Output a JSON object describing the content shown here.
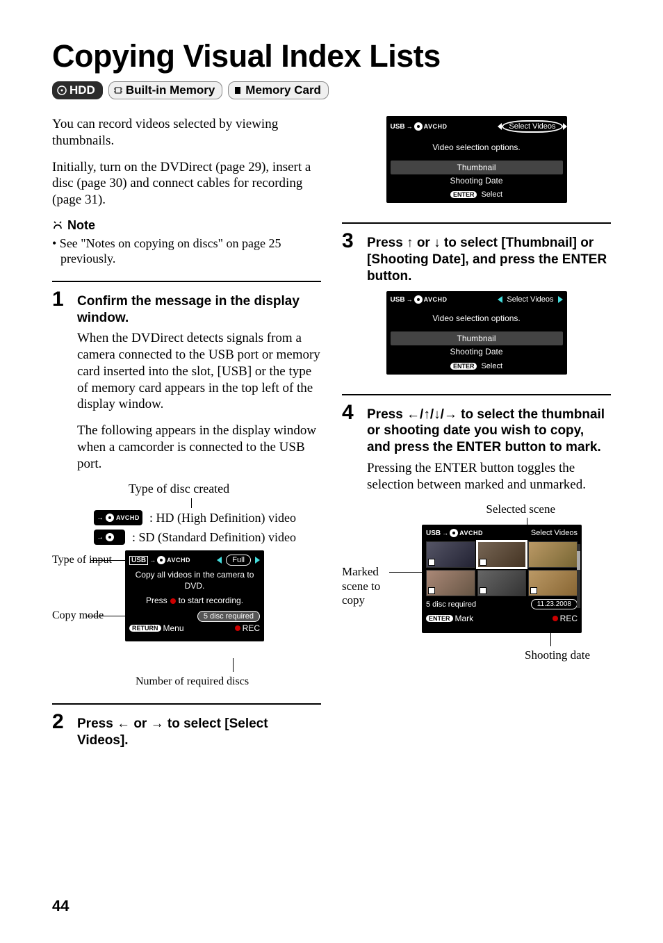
{
  "title": "Copying Visual Index Lists",
  "badges": {
    "hdd": "HDD",
    "builtin": "Built-in Memory",
    "card": "Memory Card"
  },
  "intro": {
    "p1": "You can record videos selected by viewing thumbnails.",
    "p2": "Initially, turn on the DVDirect (page 29), insert a disc (page 30) and connect cables for recording (page 31)."
  },
  "note": {
    "head": "Note",
    "body": "• See \"Notes on copying on discs\" on page 25 previously."
  },
  "step1": {
    "num": "1",
    "head": "Confirm the message in the display window.",
    "body1": "When the DVDirect detects signals from a camera connected to the USB port or memory card inserted into the slot, [USB] or the type of memory card appears in the top left of the display window.",
    "body2": "The following appears in the display window when a camcorder is connected to the USB port.",
    "caption_top": "Type of disc created",
    "legend_hd": ": HD (High Definition) video",
    "legend_sd": ": SD (Standard Definition) video",
    "label_input": "Type of input",
    "label_copy": "Copy mode",
    "caption_bottom": "Number of required discs"
  },
  "lcd1": {
    "usb": "USB",
    "avchd": "AVCHD",
    "full": "Full",
    "msg": "Copy all videos in the camera to DVD.",
    "press": "Press      to start recording.",
    "discs": "5 disc required",
    "return": "Menu",
    "return_btn": "RETURN",
    "rec": "REC"
  },
  "step2": {
    "num": "2",
    "head_prefix": "Press ",
    "head_mid": " or ",
    "head_suffix": " to select [Select Videos]."
  },
  "lcd2": {
    "usb": "USB",
    "avchd": "AVCHD",
    "sel": "Select Videos",
    "msg": "Video selection options.",
    "opt1": "Thumbnail",
    "opt2": "Shooting Date",
    "enter": "ENTER",
    "select": "Select"
  },
  "step3": {
    "num": "3",
    "head_prefix": "Press ",
    "head_mid": " or ",
    "head_mid2": " to select [Thumbnail] or [Shooting Date], and press the ENTER button."
  },
  "lcd3": {
    "usb": "USB",
    "avchd": "AVCHD",
    "sel": "Select Videos",
    "msg": "Video selection options.",
    "opt1": "Thumbnail",
    "opt2": "Shooting Date",
    "enter": "ENTER",
    "select": "Select"
  },
  "step4": {
    "num": "4",
    "head": "Press ←/↑/↓/→ to select the thumbnail or shooting date you wish to copy, and press the ENTER button to mark.",
    "body": "Pressing the ENTER button toggles the selection between marked and unmarked.",
    "lbl_selected": "Selected scene",
    "lbl_marked": "Marked scene to copy",
    "lbl_date": "Shooting date"
  },
  "lcd4": {
    "usb": "USB",
    "avchd": "AVCHD",
    "sel": "Select Videos",
    "discs": "5 disc required",
    "date": "11.23.2008",
    "enter": "ENTER",
    "mark": "Mark",
    "rec": "REC"
  },
  "page": "44"
}
